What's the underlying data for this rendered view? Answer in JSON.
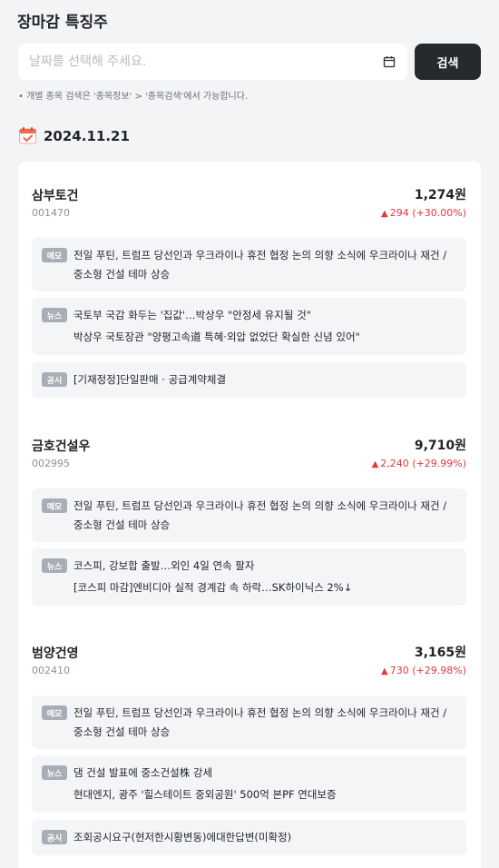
{
  "page": {
    "title": "장마감 특징주",
    "search_placeholder": "날짜를 선택해 주세요.",
    "search_button": "검색",
    "hint": "• 개별 종목 검색은 '종목정보' > '종목검색'에서 가능합니다.",
    "date": "2024.11.21"
  },
  "colors": {
    "up": "#e5383b",
    "button": "#26292d",
    "badge": "#a8adb6"
  },
  "stocks": [
    {
      "name": "삼부토건",
      "code": "001470",
      "price": "1,274원",
      "change": "294 (+30.00%)",
      "memo_label": "메모",
      "memo": "전일 푸틴, 트럼프 당선인과 우크라이나 휴전 협정 논의 의향 소식에 우크라이나 재건 / 중소형 건설 테마 상승",
      "news_label": "뉴스",
      "news": [
        "국토부 국감 화두는 '집값'…박상우 \"안정세 유지될 것\"",
        "박상우 국토장관 \"양평고속道 특혜·외압 없었단 확실한 신념 있어\""
      ],
      "disclosure_label": "공시",
      "disclosure": "[기재정정]단일판매 · 공급계약체결"
    },
    {
      "name": "금호건설우",
      "code": "002995",
      "price": "9,710원",
      "change": "2,240 (+29.99%)",
      "memo_label": "메모",
      "memo": "전일 푸틴, 트럼프 당선인과 우크라이나 휴전 협정 논의 의향 소식에 우크라이나 재건 / 중소형 건설 테마 상승",
      "news_label": "뉴스",
      "news": [
        "코스피, 강보합 출발…외인 4일 연속 팔자",
        "[코스피 마감]엔비디아 실적 경계감 속 하락…SK하이닉스 2%↓"
      ]
    },
    {
      "name": "범양건영",
      "code": "002410",
      "price": "3,165원",
      "change": "730 (+29.98%)",
      "memo_label": "메모",
      "memo": "전일 푸틴, 트럼프 당선인과 우크라이나 휴전 협정 논의 의향 소식에 우크라이나 재건 / 중소형 건설 테마 상승",
      "news_label": "뉴스",
      "news": [
        "댐 건설 발표에 중소건설株 강세",
        "현대엔지, 광주 '힐스테이트 중외공원' 500억 본PF 연대보증"
      ],
      "disclosure_label": "공시",
      "disclosure": "조회공시요구(현저한시황변동)에대한답변(미확정)"
    }
  ]
}
